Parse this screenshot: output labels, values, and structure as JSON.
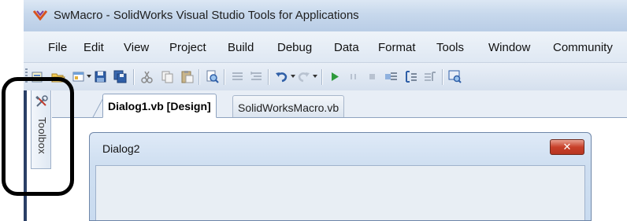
{
  "window": {
    "title": "SwMacro - SolidWorks Visual Studio Tools for Applications"
  },
  "menu": {
    "items": [
      "File",
      "Edit",
      "View",
      "Project",
      "Build",
      "Debug",
      "Data",
      "Format",
      "Tools",
      "Window",
      "Community"
    ]
  },
  "toolbar": {
    "icons": [
      "add-item-icon",
      "open-icon",
      "add-new-icon",
      "save-icon",
      "save-all-icon",
      "cut-icon",
      "copy-icon",
      "paste-icon",
      "find-icon",
      "comment-icon",
      "uncomment-icon",
      "undo-icon",
      "redo-icon",
      "start-icon",
      "pause-icon",
      "stop-icon",
      "step-into-icon",
      "step-over-icon",
      "step-out-icon",
      "find-in-files-icon"
    ]
  },
  "toolbox": {
    "label": "Toolbox"
  },
  "documents": {
    "tabs": [
      {
        "label": "Dialog1.vb [Design]",
        "active": true
      },
      {
        "label": "SolidWorksMacro.vb",
        "active": false
      }
    ]
  },
  "designer": {
    "form_title": "Dialog2",
    "close_glyph": "✕"
  },
  "colors": {
    "titlebar": "#c7d8ec",
    "close_button": "#c8402a",
    "highlight": "#000000"
  }
}
